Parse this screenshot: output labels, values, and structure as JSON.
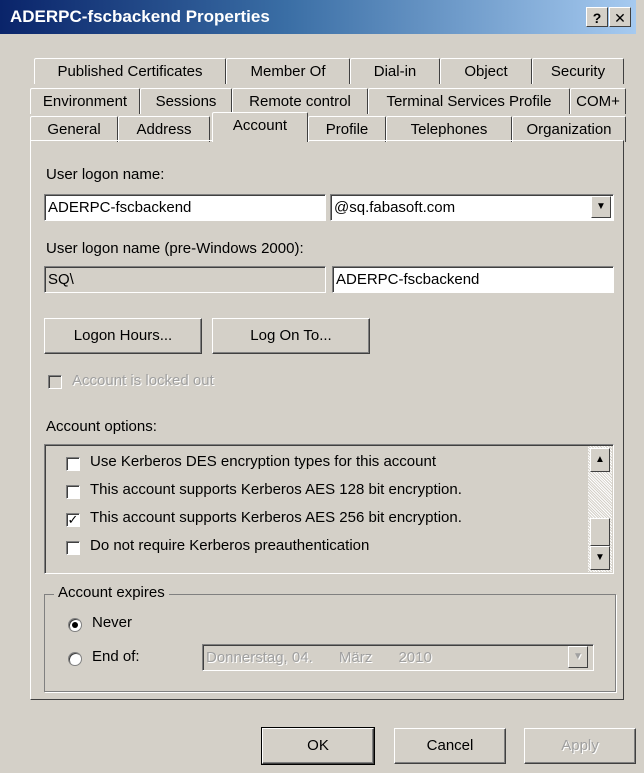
{
  "window": {
    "title": "ADERPC-fscbackend Properties",
    "help_button": "?",
    "close_button": "X"
  },
  "tabs": {
    "row1": [
      "Published Certificates",
      "Member Of",
      "Dial-in",
      "Object",
      "Security"
    ],
    "row2": [
      "Environment",
      "Sessions",
      "Remote control",
      "Terminal Services Profile",
      "COM+"
    ],
    "row3": [
      "General",
      "Address",
      "Account",
      "Profile",
      "Telephones",
      "Organization"
    ],
    "active": "Account"
  },
  "account": {
    "logon_label": "User logon name:",
    "logon_value": "ADERPC-fscbackend",
    "domain_value": "@sq.fabasoft.com",
    "pre2000_label": "User logon name (pre-Windows 2000):",
    "pre2000_domain": "SQ\\",
    "pre2000_value": "ADERPC-fscbackend",
    "logon_hours_button": "Logon Hours...",
    "log_on_to_button": "Log On To...",
    "locked_out_label": "Account is locked out",
    "options_label": "Account options:",
    "options": [
      {
        "label": "Use Kerberos DES encryption types for this account",
        "checked": false
      },
      {
        "label": "This account supports Kerberos AES 128 bit encryption.",
        "checked": false
      },
      {
        "label": "This account supports Kerberos AES 256 bit encryption.",
        "checked": true
      },
      {
        "label": "Do not require Kerberos preauthentication",
        "checked": false
      }
    ],
    "expires_label": "Account expires",
    "never_label": "Never",
    "end_of_label": "End of:",
    "date_day": "Donnerstag, 04.",
    "date_month": "März",
    "date_year": "2010",
    "expires_selected": "Never"
  },
  "footer": {
    "ok": "OK",
    "cancel": "Cancel",
    "apply": "Apply"
  }
}
